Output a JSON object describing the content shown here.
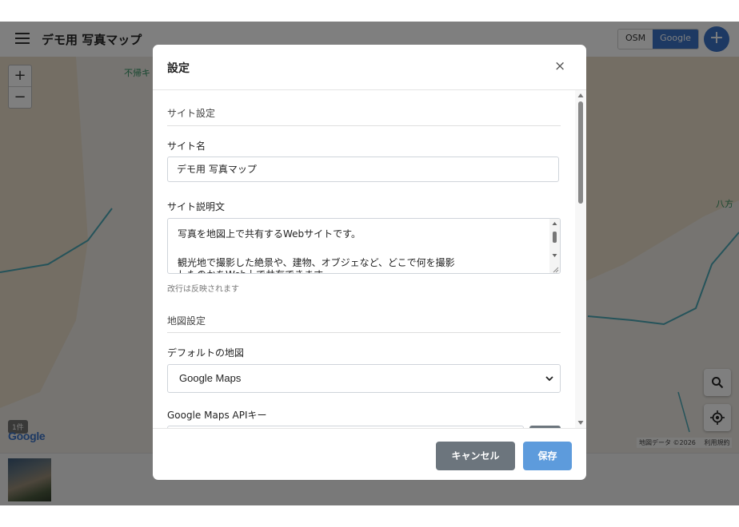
{
  "app": {
    "title": "デモ用 写真マップ",
    "map_toggle": {
      "osm": "OSM",
      "google": "Google",
      "active": "Google"
    },
    "add_button": "+"
  },
  "map": {
    "zoom_in": "+",
    "zoom_out": "−",
    "labels": {
      "place_left": "不帰キ",
      "place_right": "八方"
    },
    "photo_count": "1件",
    "logo": "Google",
    "attribution": {
      "data": "地図データ ©2026",
      "terms": "利用規約"
    },
    "colors": {
      "accent": "#3b73c7",
      "terrain": "#e8dcc8",
      "stream": "#4aa7b5"
    }
  },
  "modal": {
    "title": "設定",
    "close": "×",
    "site_section": "サイト設定",
    "site_name_label": "サイト名",
    "site_name_value": "デモ用 写真マップ",
    "site_desc_label": "サイト説明文",
    "site_desc_lines": [
      "写真を地図上で共有するWebサイトです。",
      "",
      "観光地で撮影した絶景や、建物、オブジェなど、どこで何を撮影",
      "したのかをWeb上で共有できます。"
    ],
    "site_desc_help": "改行は反映されます",
    "map_section": "地図設定",
    "default_map_label": "デフォルトの地図",
    "default_map_value": "Google Maps",
    "api_key_label": "Google Maps APIキー",
    "cancel": "キャンセル",
    "save": "保存"
  }
}
